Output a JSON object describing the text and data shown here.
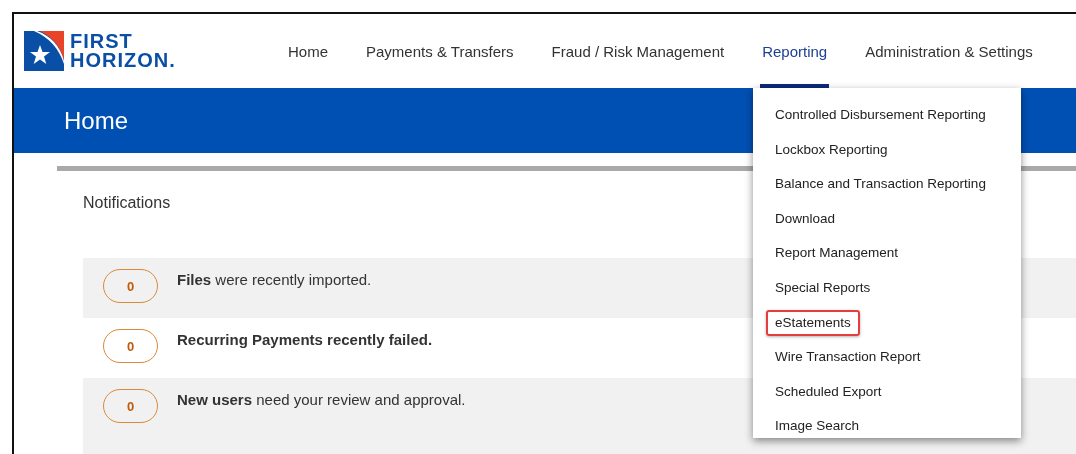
{
  "logo": {
    "line_1": "FIRST",
    "line_2": "HORIZON."
  },
  "nav": [
    {
      "label": "Home",
      "selected": false
    },
    {
      "label": "Payments & Transfers",
      "selected": false
    },
    {
      "label": "Fraud / Risk Management",
      "selected": false
    },
    {
      "label": "Reporting",
      "selected": true
    },
    {
      "label": "Administration & Settings",
      "selected": false
    }
  ],
  "page_title": "Home",
  "notifications": {
    "title": "Notifications",
    "items": [
      {
        "count": "0",
        "text": "**Files** were recently imported."
      },
      {
        "count": "0",
        "text": "**Recurring Payments recently failed.**"
      },
      {
        "count": "0",
        "text": "**New users** need your review and approval."
      }
    ]
  },
  "reporting_menu": [
    {
      "label": "Controlled Disbursement Reporting",
      "highlighted": false
    },
    {
      "label": "Lockbox Reporting",
      "highlighted": false
    },
    {
      "label": "Balance and Transaction Reporting",
      "highlighted": false
    },
    {
      "label": "Download",
      "highlighted": false
    },
    {
      "label": "Report Management",
      "highlighted": false
    },
    {
      "label": "Special Reports",
      "highlighted": false
    },
    {
      "label": "eStatements",
      "highlighted": true
    },
    {
      "label": "Wire Transaction Report",
      "highlighted": false
    },
    {
      "label": "Scheduled Export",
      "highlighted": false
    },
    {
      "label": "Image Search",
      "highlighted": false
    }
  ]
}
